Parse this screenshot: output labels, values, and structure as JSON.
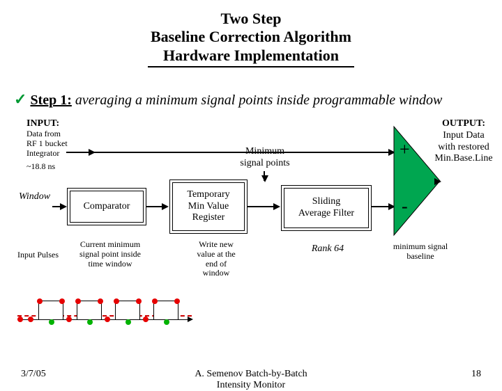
{
  "title": {
    "line1": "Two Step",
    "line2": "Baseline Correction Algorithm",
    "line3": "Hardware Implementation"
  },
  "step": {
    "check": "✓",
    "label": "Step 1:",
    "desc": "averaging a minimum signal points inside programmable window"
  },
  "labels": {
    "input_heading": "INPUT:",
    "input_line1": "Data from",
    "input_line2": "RF 1 bucket",
    "input_line3": "Integrator",
    "input_period": "~18.8 ns",
    "window": "Window",
    "comparator": "Comparator",
    "temp_reg_line1": "Temporary",
    "temp_reg_line2": "Min Value",
    "temp_reg_line3": "Register",
    "min_sig_line1": "Minimum",
    "min_sig_line2": "signal points",
    "sliding_line1": "Sliding",
    "sliding_line2": "Average Filter",
    "rank": "Rank 64",
    "baseline_line1": "minimum signal",
    "baseline_line2": "baseline",
    "output_heading": "OUTPUT:",
    "output_line1": "Input Data",
    "output_line2": "with restored",
    "output_line3": "Min.Base.Line",
    "plus": "+",
    "minus": "-",
    "input_pulses": "Input Pulses",
    "current_min_line1": "Current minimum",
    "current_min_line2": "signal point inside",
    "current_min_line3": "time window",
    "write_new_line1": "Write new",
    "write_new_line2": "value at the",
    "write_new_line3": "end of",
    "write_new_line4": "window"
  },
  "footer": {
    "date": "3/7/05",
    "title_line1": "A. Semenov    Batch-by-Batch",
    "title_line2": "Intensity Monitor",
    "page": "18"
  }
}
